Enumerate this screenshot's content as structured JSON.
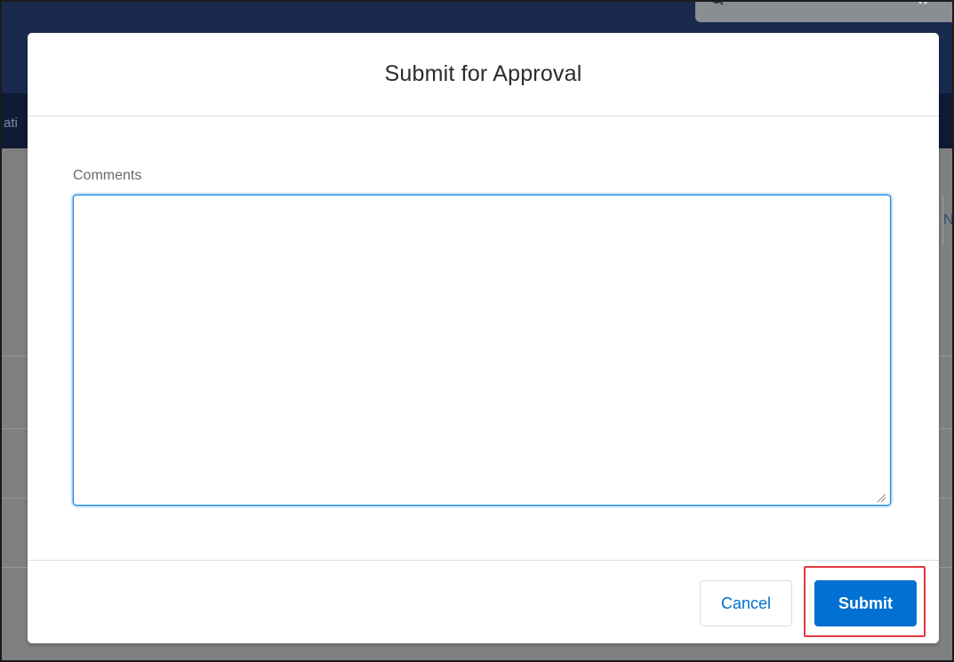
{
  "background": {
    "nav_partial_text": "ati",
    "right_tab_partial_text": "N"
  },
  "modal": {
    "title": "Submit for Approval",
    "comments_label": "Comments",
    "comments_value": "",
    "cancel_label": "Cancel",
    "submit_label": "Submit"
  },
  "colors": {
    "brand_blue": "#0070d2",
    "highlight_red": "#e0393e",
    "header_navy": "#1a2a4f"
  }
}
